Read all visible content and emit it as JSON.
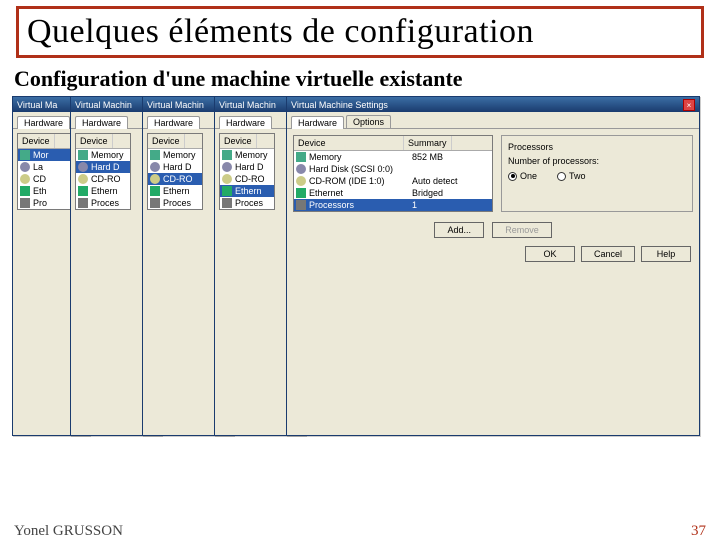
{
  "title": "Quelques éléments de configuration",
  "subtitle": "Configuration d'une machine virtuelle existante",
  "dialog_title": "Virtual Machine Settings",
  "dialog_title_short": "Virtual Ma",
  "dialog_title_mid": "Virtual Machin",
  "tabs": {
    "hardware": "Hardware",
    "options": "Options"
  },
  "columns": {
    "device": "Device",
    "summary": "Summary"
  },
  "devices_short": [
    "Memory",
    "Hard D",
    "CD-RO",
    "Ethern",
    "Proces"
  ],
  "devices_abbrev": [
    "Mor",
    "La",
    "CD",
    "Eth",
    "Pro"
  ],
  "devices": [
    {
      "name": "Memory",
      "summary": "852 MB"
    },
    {
      "name": "Hard Disk (SCSI 0:0)",
      "summary": ""
    },
    {
      "name": "CD-ROM (IDE 1:0)",
      "summary": "Auto detect"
    },
    {
      "name": "Ethernet",
      "summary": "Bridged"
    },
    {
      "name": "Processors",
      "summary": "1"
    }
  ],
  "right_panel": {
    "group": "Processors",
    "label": "Number of processors:",
    "opt1": "One",
    "opt2": "Two"
  },
  "buttons": {
    "add": "Add...",
    "remove": "Remove",
    "ok": "OK",
    "cancel": "Cancel",
    "help": "Help"
  },
  "footer": {
    "author": "Yonel GRUSSON",
    "page": "37"
  }
}
